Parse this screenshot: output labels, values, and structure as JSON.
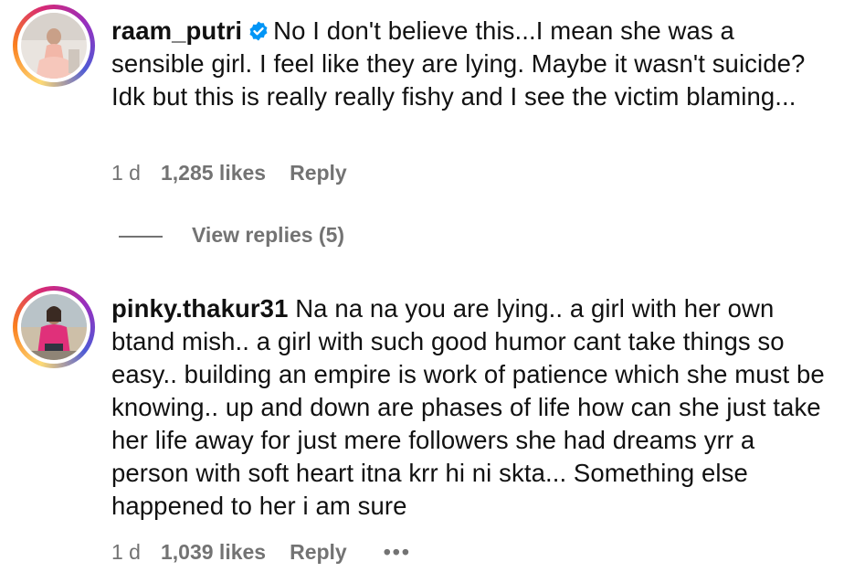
{
  "comments": [
    {
      "username": "raam_putri",
      "verified": true,
      "text": "No I don't believe this...I mean she was a sensible girl. I feel like they are lying. Maybe it wasn't suicide? Idk but this is really really fishy and I see the victim blaming...",
      "time": "1 d",
      "likes": "1,285 likes",
      "reply_label": "Reply",
      "view_replies": "View replies (5)"
    },
    {
      "username": "pinky.thakur31",
      "verified": false,
      "text": "Na na na you are lying.. a girl with her own btand mish.. a girl with such good humor cant take things so easy.. building an empire is work of patience which she must be knowing.. up and down are phases of life how can she just take her life away for just mere followers she had dreams yrr a person with soft heart itna krr hi ni skta... Something else happened to her i am sure",
      "time": "1 d",
      "likes": "1,039 likes",
      "reply_label": "Reply",
      "more_label": "•••"
    }
  ],
  "icons": {
    "verified": "verified-badge-icon",
    "more": "more-options-icon"
  },
  "colors": {
    "verified_blue": "#0095f6",
    "meta_gray": "#737373",
    "text": "#111111"
  }
}
